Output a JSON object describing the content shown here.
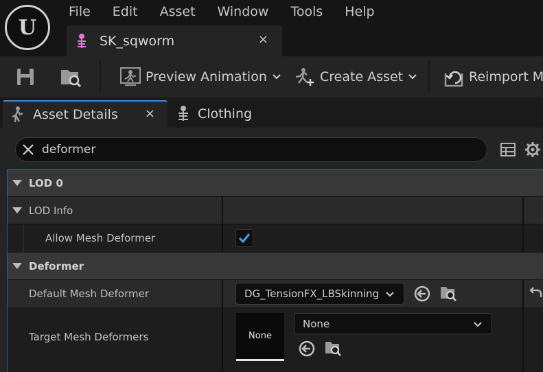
{
  "menu": [
    "File",
    "Edit",
    "Asset",
    "Window",
    "Tools",
    "Help"
  ],
  "document_tab": {
    "label": "SK_sqworm",
    "close": "×"
  },
  "toolbar": {
    "preview_animation": "Preview Animation",
    "create_asset": "Create Asset",
    "reimport": "Reimport Me"
  },
  "panel_tabs": {
    "asset_details": "Asset Details",
    "clothing": "Clothing",
    "close": "×"
  },
  "search": {
    "value": "deformer"
  },
  "properties": {
    "lod0": "LOD 0",
    "lod_info": "LOD Info",
    "allow_mesh_deformer": "Allow Mesh Deformer",
    "allow_mesh_deformer_checked": true,
    "deformer": "Deformer",
    "default_mesh_deformer": "Default Mesh Deformer",
    "default_mesh_deformer_value": "DG_TensionFX_LBSkinning",
    "target_mesh_deformers": "Target Mesh Deformers",
    "target_thumb": "None",
    "target_value": "None"
  },
  "colors": {
    "accent": "#3c88d8",
    "check": "#4a9cf0"
  }
}
